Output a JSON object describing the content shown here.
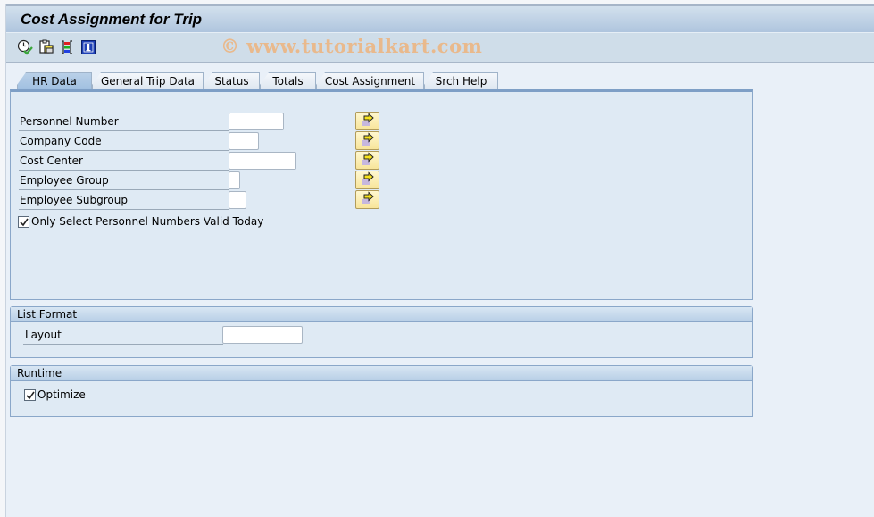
{
  "window": {
    "title": "Cost Assignment for Trip",
    "watermark": "© www.tutorialkart.com"
  },
  "toolbar": {
    "icons": [
      {
        "name": "execute-icon",
        "tooltip": "Execute"
      },
      {
        "name": "get-variant-icon",
        "tooltip": "Get Variant"
      },
      {
        "name": "dynamic-selections-icon",
        "tooltip": "Dynamic Selections"
      },
      {
        "name": "info-icon",
        "tooltip": "Program Documentation"
      }
    ]
  },
  "tabs": [
    {
      "label": "HR Data",
      "active": true
    },
    {
      "label": "General Trip Data",
      "active": false
    },
    {
      "label": "Status",
      "active": false
    },
    {
      "label": "Totals",
      "active": false
    },
    {
      "label": "Cost Assignment",
      "active": false
    },
    {
      "label": "Srch Help",
      "active": false
    }
  ],
  "hr_data": {
    "fields": [
      {
        "label": "Personnel Number",
        "value": ""
      },
      {
        "label": "Company Code",
        "value": ""
      },
      {
        "label": "Cost Center",
        "value": ""
      },
      {
        "label": "Employee Group",
        "value": ""
      },
      {
        "label": "Employee Subgroup",
        "value": ""
      }
    ],
    "valid_today": {
      "label": "Only Select Personnel Numbers Valid Today",
      "checked": true
    }
  },
  "list_format": {
    "title": "List Format",
    "layout_label": "Layout",
    "layout_value": ""
  },
  "runtime": {
    "title": "Runtime",
    "optimize_label": "Optimize",
    "optimize_checked": true
  }
}
